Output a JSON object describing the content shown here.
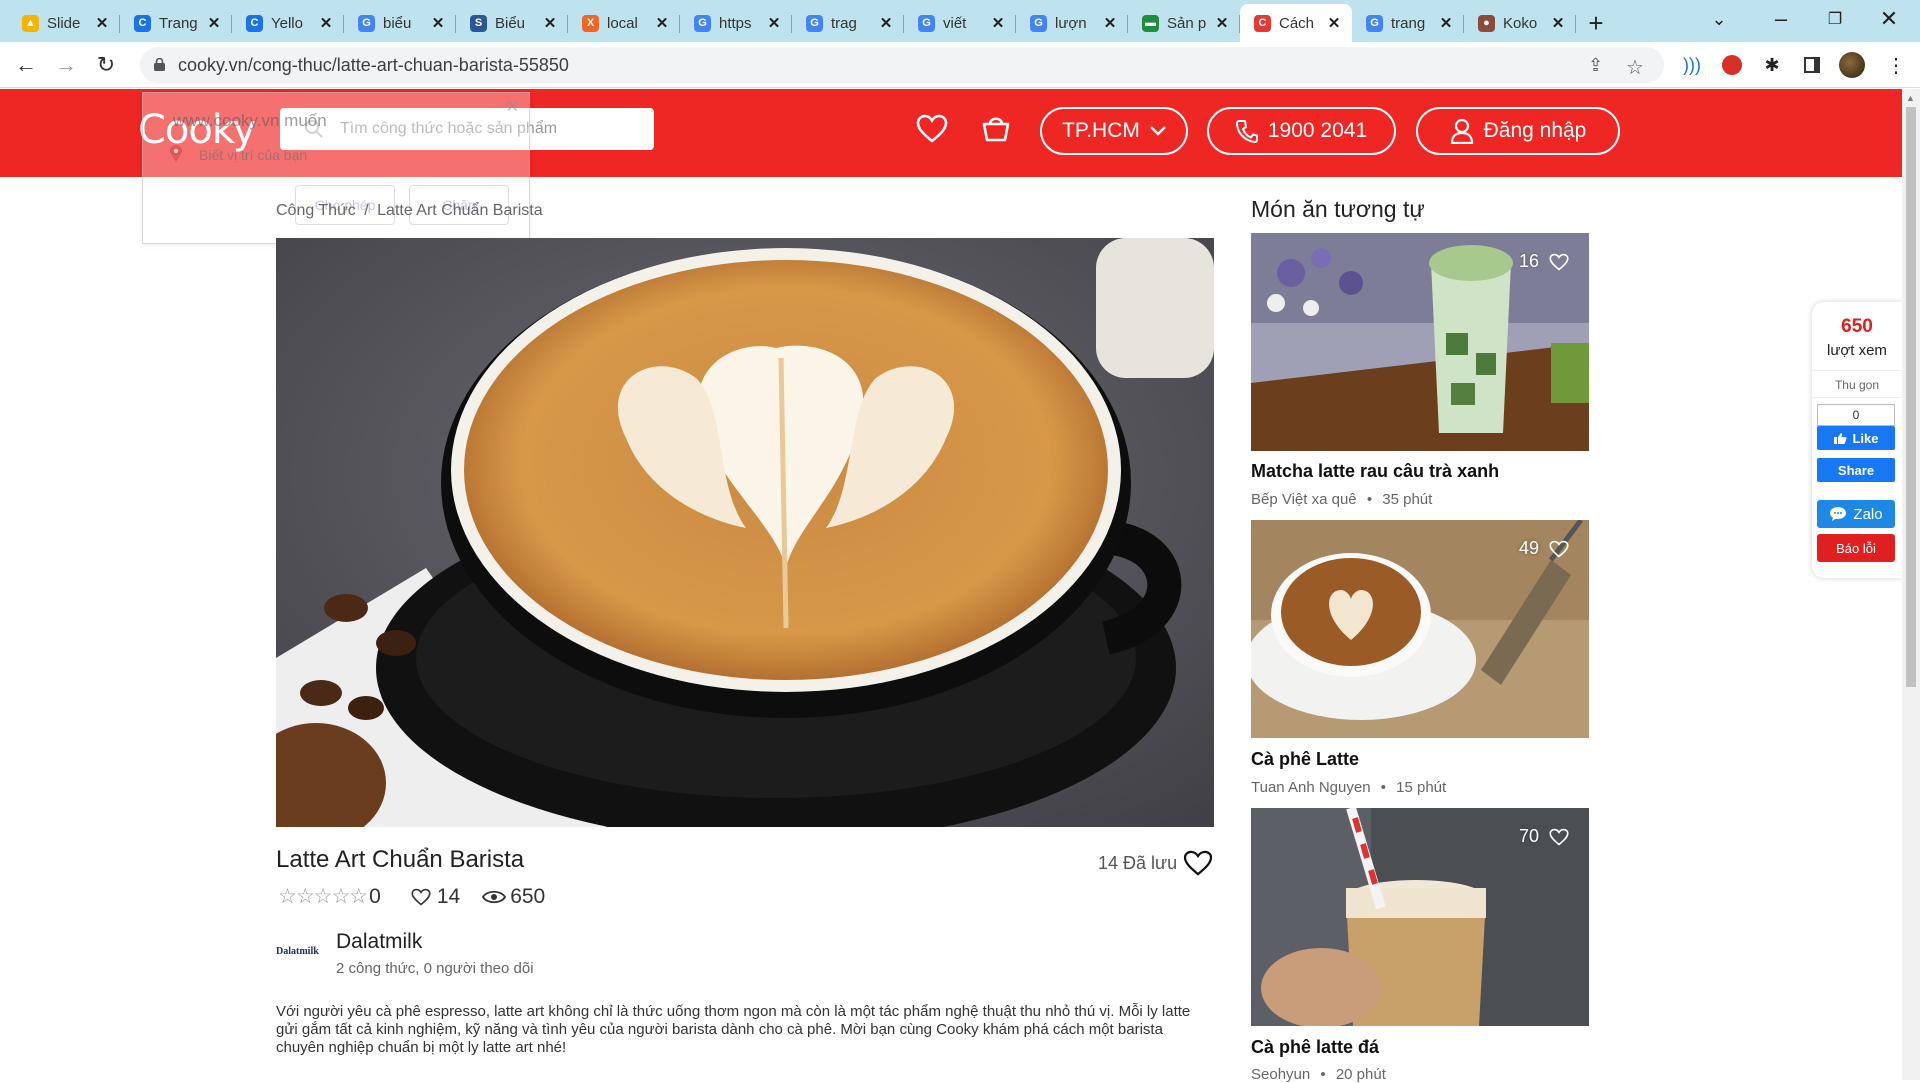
{
  "browser": {
    "tabs": [
      {
        "label": "Slide",
        "color": "#f4b400",
        "glyph": "▲"
      },
      {
        "label": "Trang",
        "color": "#1a73e8",
        "glyph": "C"
      },
      {
        "label": "Yello",
        "color": "#1a73e8",
        "glyph": "C"
      },
      {
        "label": "biểu",
        "color": "#4285f4",
        "glyph": "G"
      },
      {
        "label": "Biểu",
        "color": "#2b579a",
        "glyph": "S"
      },
      {
        "label": "local",
        "color": "#f26522",
        "glyph": "X"
      },
      {
        "label": "https",
        "color": "#4285f4",
        "glyph": "G"
      },
      {
        "label": "trag",
        "color": "#4285f4",
        "glyph": "G"
      },
      {
        "label": "viết",
        "color": "#4285f4",
        "glyph": "G"
      },
      {
        "label": "lượn",
        "color": "#4285f4",
        "glyph": "G"
      },
      {
        "label": "Sản p",
        "color": "#1e8e3e",
        "glyph": "▬"
      },
      {
        "label": "Cách",
        "color": "#e53935",
        "glyph": "C",
        "active": true
      },
      {
        "label": "trang",
        "color": "#4285f4",
        "glyph": "G"
      },
      {
        "label": "Koko",
        "color": "#8d4b3a",
        "glyph": "●"
      }
    ],
    "url": "cooky.vn/cong-thuc/latte-art-chuan-barista-55850"
  },
  "header": {
    "logo": "Cooky",
    "search_placeholder": "Tìm công thức hoặc sản phẩm",
    "city": "TP.HCM",
    "phone": "1900 2041",
    "login": "Đăng nhập"
  },
  "location_popup": {
    "title": "www.cooky.vn muốn",
    "subtitle": "Biết vị trí của bạn",
    "allow": "Cho phép",
    "block": "Chặn"
  },
  "breadcrumb": {
    "root": "Công Thức",
    "separator": "/",
    "current": "Latte Art Chuẩn Barista"
  },
  "recipe": {
    "title": "Latte Art Chuẩn Barista",
    "saved_label": "14 Đã lưu",
    "rating_count": "0",
    "likes": "14",
    "views": "650",
    "author": {
      "logo_text": "Dalatmilk",
      "name": "Dalatmilk",
      "meta": "2 công thức, 0 người theo dõi"
    },
    "description": "Với người yêu cà phê espresso, latte art không chỉ là thức uống thơm ngon mà còn là một tác phẩm nghệ thuật thu nhỏ thú vị. Mỗi ly latte gửi gắm tất cả kinh nghiệm, kỹ năng và tình yêu của người barista dành cho cà phê. Mời bạn cùng Cooky khám phá cách một barista chuyên nghiệp chuẩn bị một ly latte art nhé!"
  },
  "sidebar": {
    "heading": "Món ăn tương tự",
    "cards": [
      {
        "count": "16",
        "title": "Matcha latte rau câu trà xanh",
        "author": "Bếp Việt xa quê",
        "time": "35 phút"
      },
      {
        "count": "49",
        "title": "Cà phê Latte",
        "author": "Tuan Anh Nguyen",
        "time": "15 phút"
      },
      {
        "count": "70",
        "title": "Cà phê latte đá",
        "author": "Seohyun",
        "time": "20 phút"
      }
    ]
  },
  "widget": {
    "views": "650",
    "views_label": "lượt xem",
    "collapse": "Thu gọn",
    "like_count": "0",
    "like": "Like",
    "share": "Share",
    "zalo": "Zalo",
    "report": "Báo lỗi"
  },
  "colors": {
    "brand_red": "#ee2624",
    "tab_strip": "#bfe3ee"
  }
}
